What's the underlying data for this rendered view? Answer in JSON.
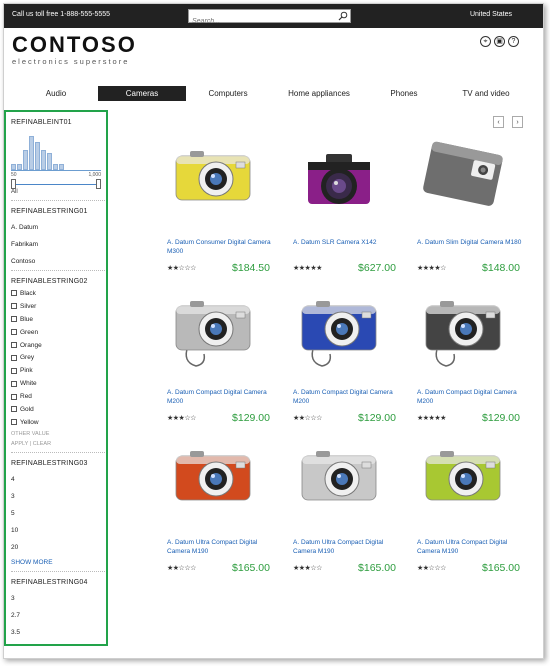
{
  "topbar": {
    "phone": "Call us toll free 1-888-555-5555",
    "search_placeholder": "Search...",
    "country": "United States"
  },
  "header": {
    "brand": "CONTOSO",
    "tagline": "electronics superstore",
    "icons": [
      "location-icon",
      "cart-icon",
      "help-icon"
    ]
  },
  "nav": {
    "tabs": [
      {
        "label": "Audio",
        "active": false
      },
      {
        "label": "Cameras",
        "active": true
      },
      {
        "label": "Computers",
        "active": false
      },
      {
        "label": "Home appliances",
        "active": false
      },
      {
        "label": "Phones",
        "active": false
      },
      {
        "label": "TV and video",
        "active": false
      }
    ]
  },
  "sidebar": {
    "int_refiner": {
      "title": "REFINABLEINT01",
      "histogram": [
        2,
        2,
        7,
        12,
        10,
        7,
        6,
        2,
        2
      ],
      "min": "50",
      "max": "1,000",
      "all_label": "All"
    },
    "string01": {
      "title": "REFINABLESTRING01",
      "items": [
        "A. Datum",
        "Fabrikam",
        "Contoso"
      ]
    },
    "string02": {
      "title": "REFINABLESTRING02",
      "colors": [
        "Black",
        "Silver",
        "Blue",
        "Green",
        "Orange",
        "Grey",
        "Pink",
        "White",
        "Red",
        "Gold",
        "Yellow"
      ],
      "other_value": "OTHER VALUE",
      "apply": "APPLY",
      "clear": "CLEAR"
    },
    "string03": {
      "title": "REFINABLESTRING03",
      "items": [
        "4",
        "3",
        "5",
        "10",
        "20"
      ],
      "show_more": "SHOW MORE"
    },
    "string04": {
      "title": "REFINABLESTRING04",
      "items": [
        "3",
        "2.7",
        "3.5"
      ]
    }
  },
  "pager": {
    "prev": "‹",
    "next": "›"
  },
  "products": [
    {
      "name": "A. Datum Consumer Digital Camera M300",
      "stars": 2,
      "price": "$184.50",
      "color": "#e6d83a"
    },
    {
      "name": "A. Datum SLR Camera X142",
      "stars": 5,
      "price": "$627.00",
      "color": "#8a1f88"
    },
    {
      "name": "A. Datum Slim Digital Camera M180",
      "stars": 4,
      "price": "$148.00",
      "color": "#6e6e6e"
    },
    {
      "name": "A. Datum Compact Digital Camera M200",
      "stars": 3,
      "price": "$129.00",
      "color": "#b9b9b9"
    },
    {
      "name": "A. Datum Compact Digital Camera M200",
      "stars": 2,
      "price": "$129.00",
      "color": "#2a49b3"
    },
    {
      "name": "A. Datum Compact Digital Camera M200",
      "stars": 5,
      "price": "$129.00",
      "color": "#444444"
    },
    {
      "name": "A. Datum Ultra Compact Digital Camera M190",
      "stars": 2,
      "price": "$165.00",
      "color": "#d24a1e"
    },
    {
      "name": "A. Datum Ultra Compact Digital Camera M190",
      "stars": 3,
      "price": "$165.00",
      "color": "#c8c8c8"
    },
    {
      "name": "A. Datum Ultra Compact Digital Camera M190",
      "stars": 2,
      "price": "$165.00",
      "color": "#a8c832"
    }
  ]
}
